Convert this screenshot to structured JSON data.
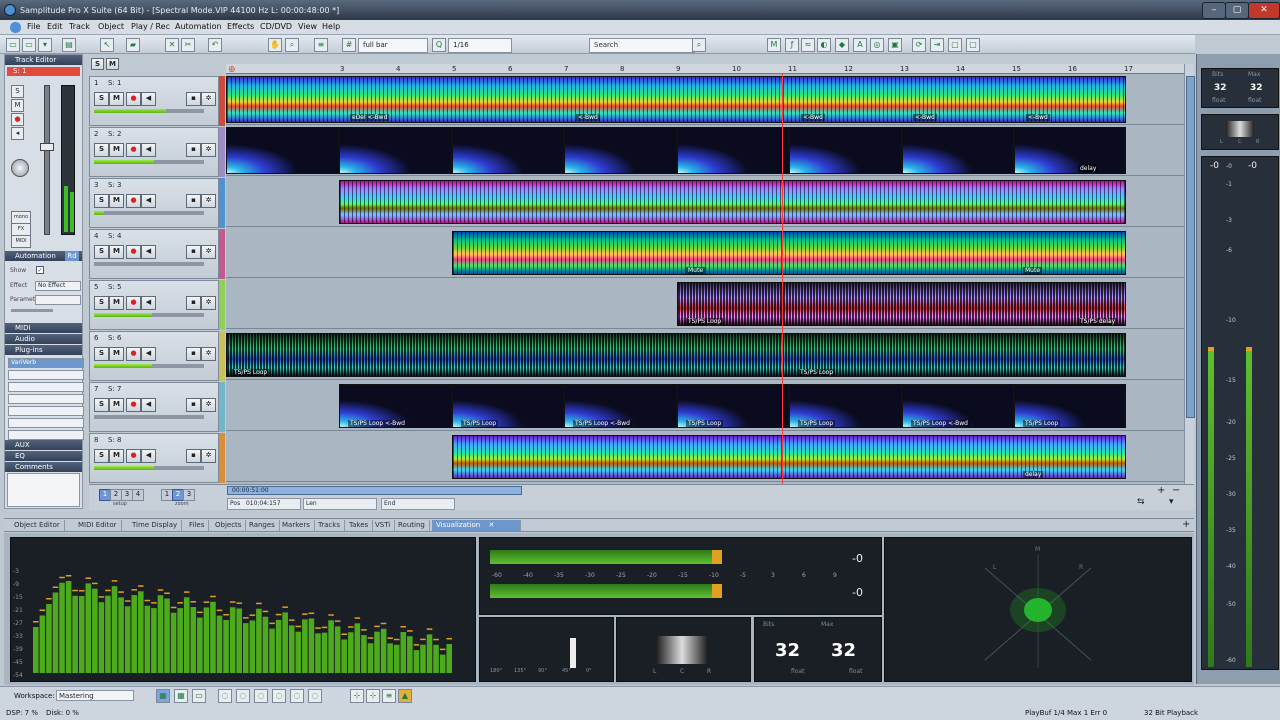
{
  "window": {
    "title": "Samplitude Pro X Suite (64 Bit) - [Spectral Mode.VIP   44100 Hz L: 00:00:48:00 *]"
  },
  "menu": [
    "File",
    "Edit",
    "Track",
    "Object",
    "Play / Rec",
    "Automation",
    "Effects",
    "CD/DVD",
    "View",
    "Help"
  ],
  "toolbar": {
    "grid": "full bar",
    "quantize": "1/16",
    "search_placeholder": "Search"
  },
  "track_editor": {
    "title": "Track Editor",
    "track": "S: 1",
    "automation": "Automation",
    "automation_mode": "Rd",
    "show": "Show",
    "effect": "Effect",
    "effect_value": "No Effect",
    "parameter": "Parameter",
    "sections": [
      "MIDI",
      "Audio",
      "Plug-ins"
    ],
    "plugin": "VariVerb",
    "bottom_sections": [
      "AUX",
      "EQ",
      "Comments"
    ]
  },
  "tracks": [
    {
      "num": "1",
      "name": "S: 1"
    },
    {
      "num": "2",
      "name": "S: 2"
    },
    {
      "num": "3",
      "name": "S: 3"
    },
    {
      "num": "4",
      "name": "S: 4"
    },
    {
      "num": "5",
      "name": "S: 5"
    },
    {
      "num": "6",
      "name": "S: 6"
    },
    {
      "num": "7",
      "name": "S: 7"
    },
    {
      "num": "8",
      "name": "S: 8"
    }
  ],
  "ruler": [
    "3",
    "4",
    "5",
    "6",
    "7",
    "8",
    "9",
    "10",
    "11",
    "12",
    "13",
    "14",
    "15",
    "16",
    "17"
  ],
  "clip_labels": {
    "del": "eDel  <-Bwd",
    "bwd": "<-Bwd",
    "delay": "delay",
    "mute": "Mute",
    "tsps_loop": "TS/PS  Loop",
    "tsps_delay": "TS/PS delay",
    "tsps_loop_bwd": "TS/PS  Loop  <-Bwd"
  },
  "transport": {
    "pos_label": "Pos",
    "pos_value": "010:04:157",
    "len_label": "Len",
    "end_label": "End",
    "time": "00:00:51:00",
    "setup": "setup",
    "zoom": "zoom"
  },
  "tabs": [
    {
      "label": "Object Editor"
    },
    {
      "label": "MIDI Editor"
    },
    {
      "label": "Time Display"
    },
    {
      "label": "Files"
    },
    {
      "label": "Objects"
    },
    {
      "label": "Ranges"
    },
    {
      "label": "Markers"
    },
    {
      "label": "Tracks"
    },
    {
      "label": "Takes"
    },
    {
      "label": "VSTi"
    },
    {
      "label": "Routing"
    },
    {
      "label": "Visualization",
      "active": true
    }
  ],
  "visualization": {
    "spectrum_db": [
      "-3",
      "-9",
      "-15",
      "-21",
      "-27",
      "-33",
      "-39",
      "-45",
      "-54"
    ],
    "meter_scale": [
      "-60",
      "-40",
      "-35",
      "-30",
      "-25",
      "-20",
      "-15",
      "-10",
      "-5",
      "3",
      "6",
      "9"
    ],
    "meter_peak_l": "-0",
    "meter_peak_r": "-0",
    "phase_angles": [
      "180°",
      "135°",
      "90°",
      "45°",
      "0°"
    ],
    "bits_left_label": "Bits",
    "bits_left": "32",
    "bits_right_label": "Max",
    "bits_right": "32",
    "float": "float",
    "corr_l": "L",
    "corr_c": "C",
    "corr_r": "R",
    "gonio_m": "M",
    "gonio_l": "L",
    "gonio_r": "R"
  },
  "master": {
    "bits": "32",
    "max": "32",
    "bits_label": "Bits",
    "max_label": "Max",
    "float": "float",
    "peak_l": "-0",
    "peak_r": "-0",
    "scale": [
      "-0",
      "-1",
      "-3",
      "-6",
      "-10",
      "-15",
      "-20",
      "-25",
      "-30",
      "-35",
      "-40",
      "-50",
      "-60"
    ],
    "corr_l": "L",
    "corr_c": "C",
    "corr_r": "R"
  },
  "status": {
    "workspace_label": "Workspace:",
    "workspace": "Mastering",
    "dsp": "DSP: 7 %",
    "disk": "Disk:  0 %",
    "playbuf": "PlayBuf 1/4  Max 1  Err 0",
    "bitplay": "32 Bit Playback"
  },
  "colors": {
    "accent": "#6d96cc",
    "meter_green": "#4caa1c",
    "peak_orange": "#e0a020"
  }
}
